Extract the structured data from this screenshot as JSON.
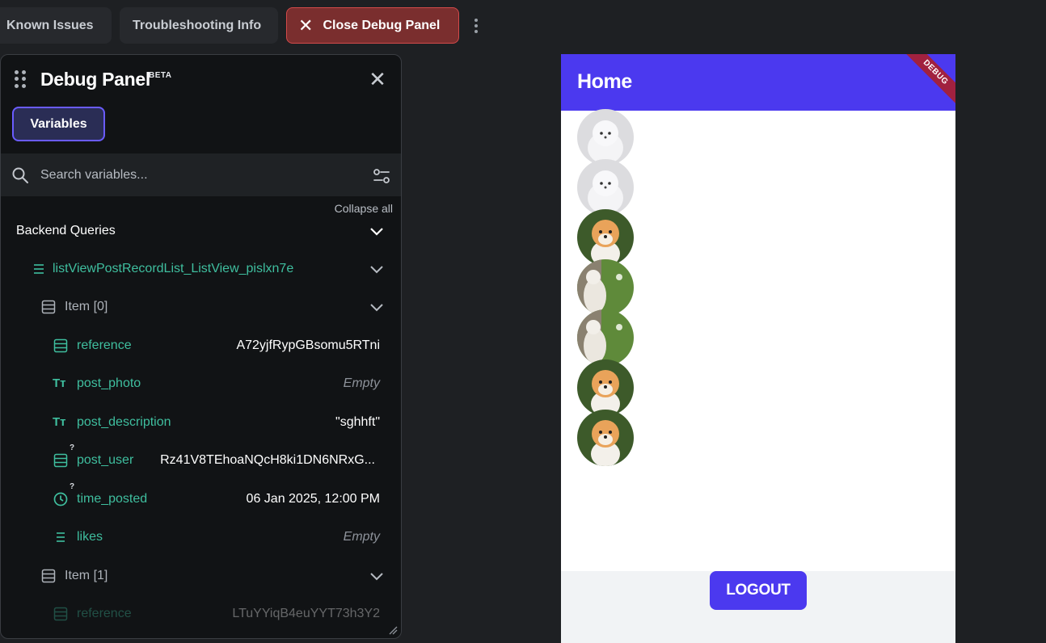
{
  "toolbar": {
    "known_issues": "Known Issues",
    "troubleshooting": "Troubleshooting Info",
    "close_debug": "Close Debug Panel"
  },
  "panel": {
    "title": "Debug Panel",
    "badge": "BETA",
    "tab_variables": "Variables",
    "search_placeholder": "Search variables...",
    "collapse_all": "Collapse all",
    "section": "Backend Queries",
    "query_name": "listViewPostRecordList_ListView_pislxn7e",
    "item0": "Item [0]",
    "fields": [
      {
        "name": "reference",
        "value": "A72yjfRypGBsomu5RTni",
        "icon": "document-ref-icon"
      },
      {
        "name": "post_photo",
        "value": "Empty",
        "icon": "text-type-icon"
      },
      {
        "name": "post_description",
        "value": "\"sghhft\"",
        "icon": "text-type-icon"
      },
      {
        "name": "post_user",
        "value": "Rz41V8TEhoaNQcH8ki1DN6NRxG...",
        "icon": "document-ref-icon"
      },
      {
        "name": "time_posted",
        "value": "06 Jan 2025, 12:00 PM",
        "icon": "clock-icon"
      },
      {
        "name": "likes",
        "value": "Empty",
        "icon": "list-icon"
      }
    ],
    "nullable_mark": "?",
    "item1": "Item [1]",
    "item1_reference": {
      "name": "reference",
      "value": "LTuYYiqB4euYYT73h3Y2"
    }
  },
  "preview": {
    "title": "Home",
    "ribbon": "DEBUG",
    "logout": "LOGOUT",
    "avatars": [
      "white-pomeranian",
      "white-pomeranian",
      "orange-pomeranian",
      "white-dog-on-grass",
      "white-dog-on-grass",
      "orange-pomeranian",
      "orange-pomeranian"
    ]
  },
  "colors": {
    "brand": "#4b39ef",
    "teal": "#3fbf9f",
    "danger": "#7a2e2e",
    "ribbon": "#a1213f"
  }
}
